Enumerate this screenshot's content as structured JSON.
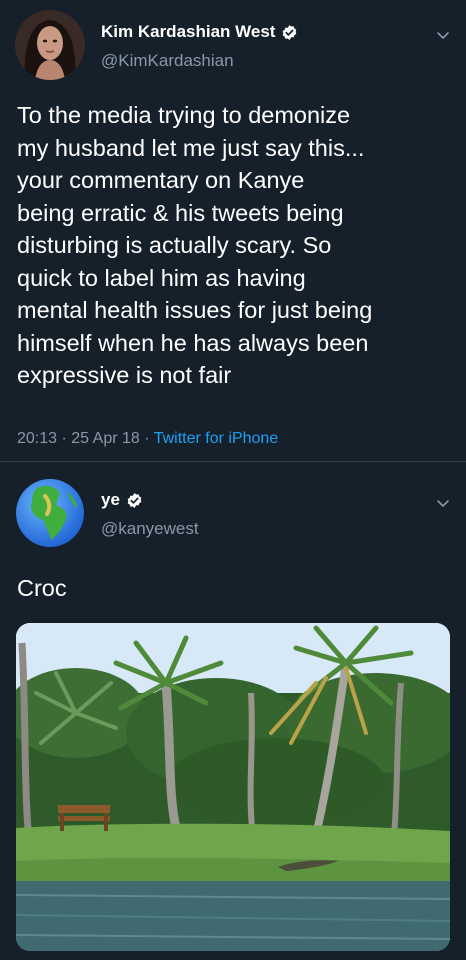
{
  "tweets": [
    {
      "display_name": "Kim Kardashian West",
      "handle": "@KimKardashian",
      "verified": true,
      "body": "To the media trying to demonize\nmy husband let me just say this...\nyour commentary on Kanye\nbeing erratic & his tweets being\ndisturbing is actually scary. So\nquick to label him as having\nmental health issues for just being\nhimself when he has always been\nexpressive is not fair",
      "time": "20:13",
      "date": "25 Apr 18",
      "separator": "·",
      "source": "Twitter for iPhone"
    },
    {
      "display_name": "ye",
      "handle": "@kanyewest",
      "verified": true,
      "body": "Croc",
      "media_icon": "photo-garden-palm-trees-lake-crocodile"
    }
  ],
  "icons": {
    "verified": "verified-badge-icon",
    "chevron": "chevron-down-icon",
    "avatar2": "globe-emoji-icon"
  },
  "colors": {
    "background": "#15202b",
    "text": "#ffffff",
    "secondary": "#8899a6",
    "accent": "#1da1f2"
  }
}
